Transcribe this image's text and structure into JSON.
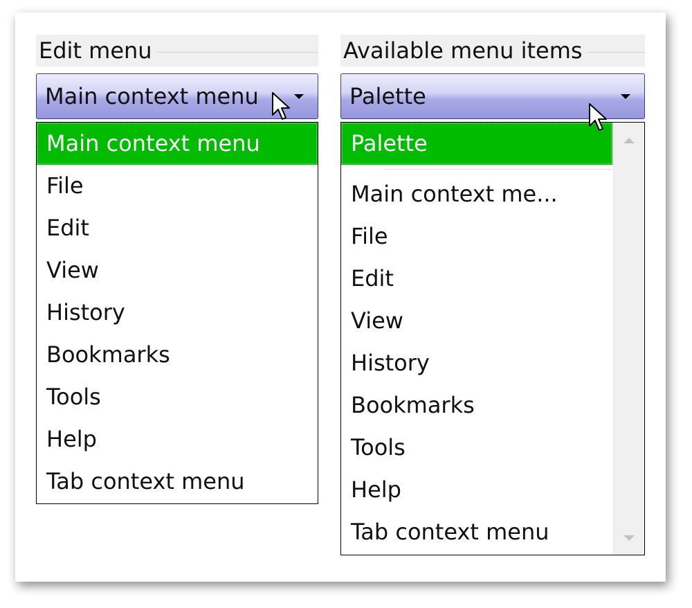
{
  "edit_menu": {
    "group_label": "Edit menu",
    "combo_value": "Main context menu",
    "selected_index": 0,
    "items": [
      {
        "label": "Main context menu"
      },
      {
        "label": "File"
      },
      {
        "label": "Edit"
      },
      {
        "label": "View"
      },
      {
        "label": "History"
      },
      {
        "label": "Bookmarks"
      },
      {
        "label": "Tools"
      },
      {
        "label": "Help"
      },
      {
        "label": "Tab context menu"
      }
    ]
  },
  "available_items": {
    "group_label": "Available menu items",
    "combo_value": "Palette",
    "selected_index": 0,
    "items": [
      {
        "label": "Palette"
      },
      {
        "label": "Main context me..."
      },
      {
        "label": "File"
      },
      {
        "label": "Edit"
      },
      {
        "label": "View"
      },
      {
        "label": "History"
      },
      {
        "label": "Bookmarks"
      },
      {
        "label": "Tools"
      },
      {
        "label": "Help"
      },
      {
        "label": "Tab context menu"
      }
    ]
  },
  "colors": {
    "selected_background": "#00bb00",
    "selected_text": "#ffffff",
    "combo_gradient_top": "#ececfb",
    "combo_gradient_bottom": "#9797de"
  },
  "icons": {
    "dropdown": "chevron-down-icon",
    "cursor": "mouse-pointer-icon"
  }
}
